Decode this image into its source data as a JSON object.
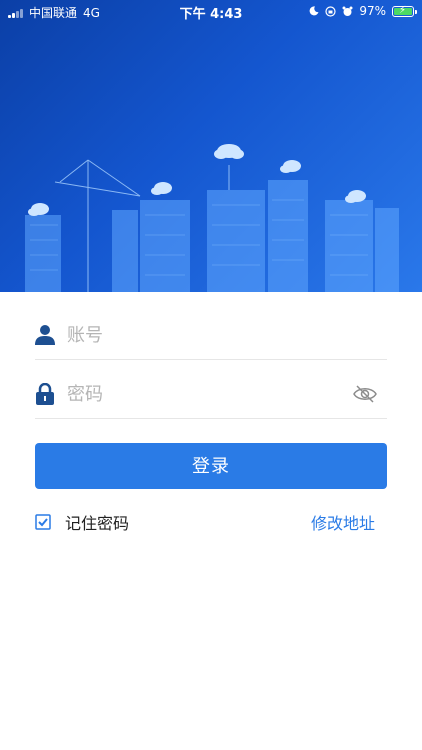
{
  "status_bar": {
    "carrier": "中国联通",
    "network": "4G",
    "time": "下午 4:43",
    "battery": "97%"
  },
  "login_form": {
    "account_placeholder": "账号",
    "password_placeholder": "密码",
    "login_label": "登录",
    "remember_label": "记住密码",
    "modify_address_label": "修改地址",
    "remember_checked": true
  },
  "colors": {
    "primary": "#2a7be6",
    "hero_dark": "#0b3fa6",
    "hero_light": "#2a78ea",
    "battery_green": "#4cd964"
  },
  "icons": {
    "account": "user-icon",
    "password": "lock-icon",
    "toggle_password": "eye-off-icon",
    "remember": "checkbox-checked-icon",
    "night": "moon-icon",
    "alarm": "alarm-icon",
    "orientation": "orientation-lock-icon"
  }
}
